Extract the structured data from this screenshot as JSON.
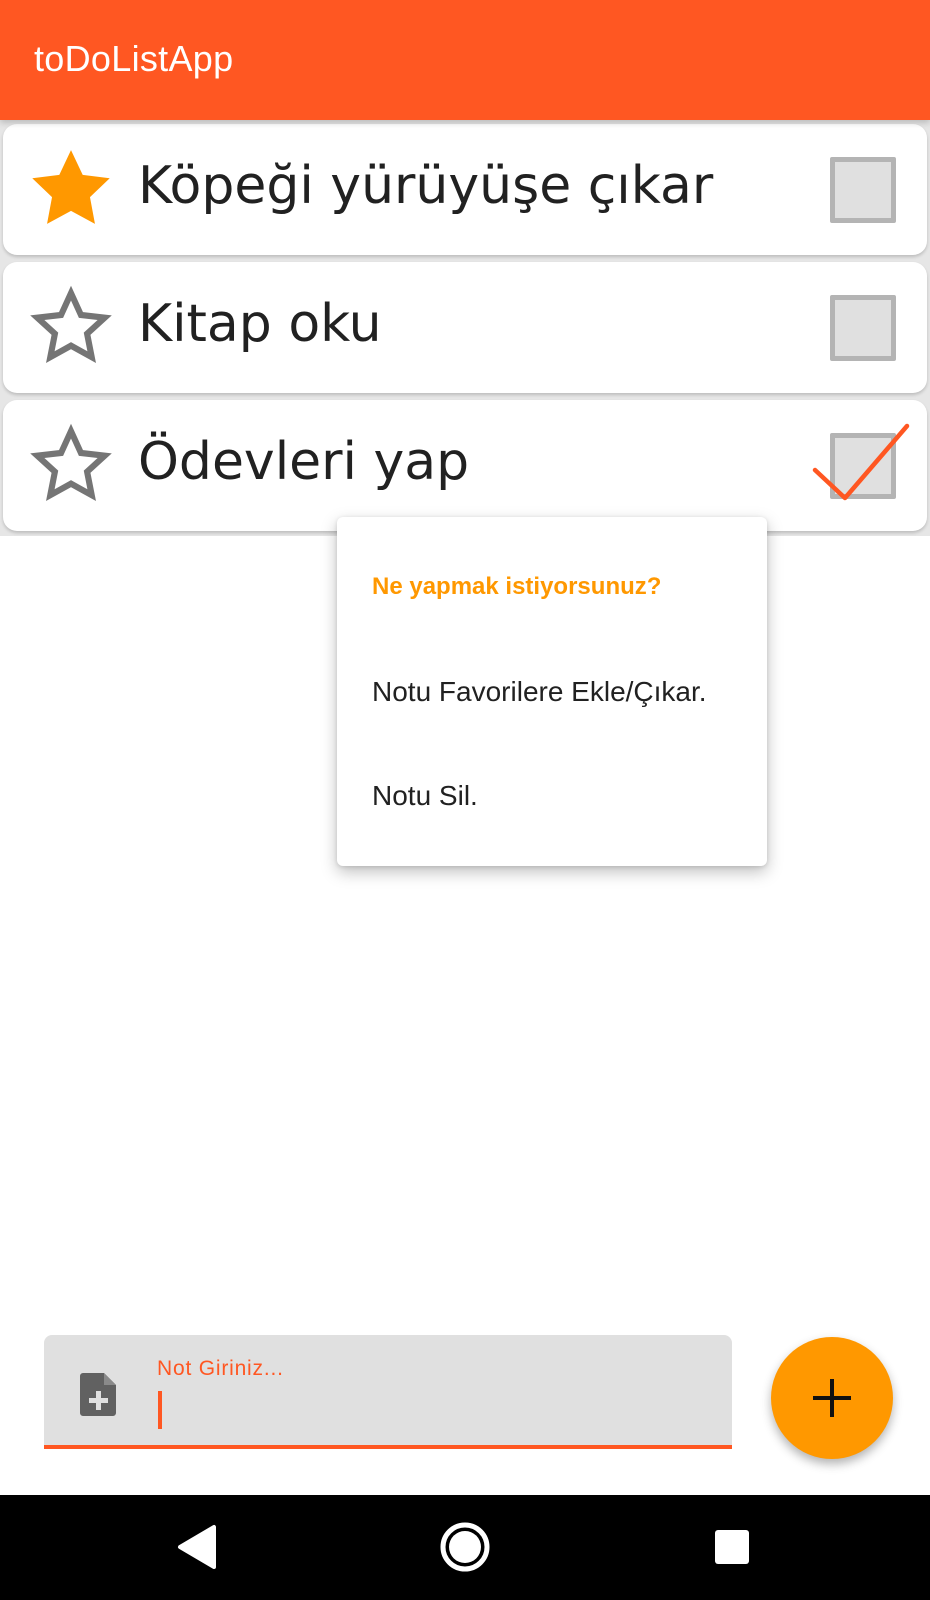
{
  "app": {
    "title": "toDoListApp"
  },
  "colors": {
    "primary": "#FF5722",
    "accent": "#FF9800",
    "text": "#212121"
  },
  "todos": [
    {
      "title": "Köpeği yürüyüşe çıkar",
      "favorite": true,
      "completed": false
    },
    {
      "title": "Kitap oku",
      "favorite": false,
      "completed": false
    },
    {
      "title": "Ödevleri yap",
      "favorite": false,
      "completed": true
    }
  ],
  "dialog": {
    "title": "Ne yapmak istiyorsunuz?",
    "options": [
      "Notu Favorilere Ekle/Çıkar.",
      "Notu Sil."
    ]
  },
  "input": {
    "label": "Not Giriniz...",
    "value": "",
    "icon": "note-add-icon"
  },
  "fab": {
    "icon": "plus-icon"
  },
  "navbar": {
    "icons": [
      "back-icon",
      "home-icon",
      "recents-icon"
    ]
  }
}
